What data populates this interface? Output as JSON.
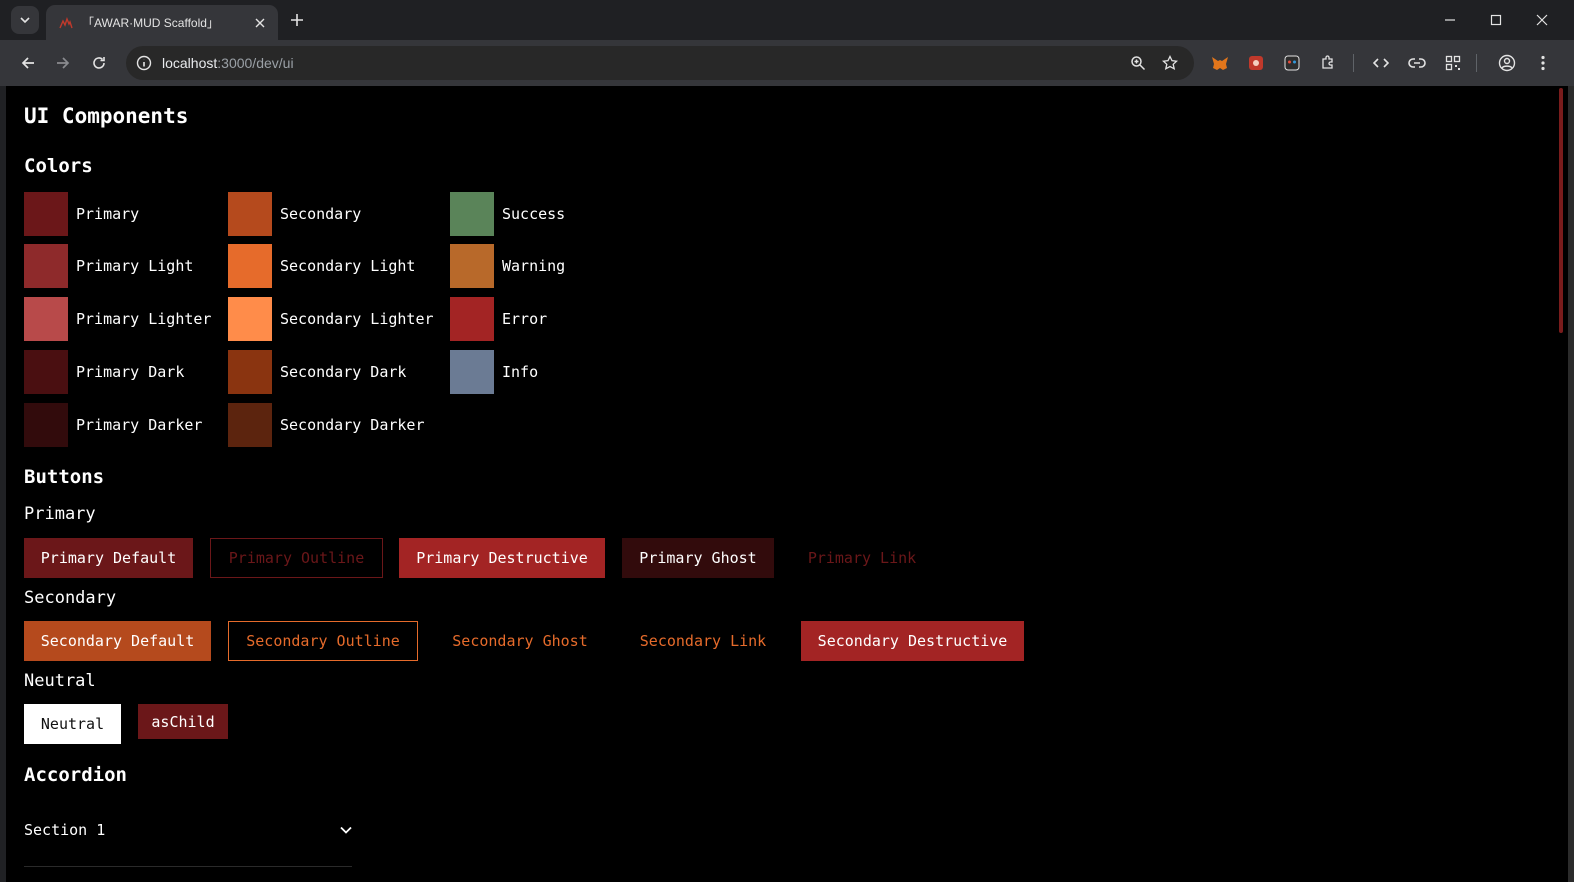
{
  "browser": {
    "tab_title": "「AWAR·MUD Scaffold」",
    "url_host": "localhost",
    "url_path": ":3000/dev/ui"
  },
  "page": {
    "title": "UI Components",
    "colors_heading": "Colors",
    "swatches": {
      "primary": [
        {
          "label": "Primary",
          "color": "#6b1719"
        },
        {
          "label": "Primary Light",
          "color": "#8e2a2b"
        },
        {
          "label": "Primary Lighter",
          "color": "#b84a4a"
        },
        {
          "label": "Primary Dark",
          "color": "#4a0f11"
        },
        {
          "label": "Primary Darker",
          "color": "#320b0c"
        }
      ],
      "secondary": [
        {
          "label": "Secondary",
          "color": "#b54a1d"
        },
        {
          "label": "Secondary Light",
          "color": "#e66b2b"
        },
        {
          "label": "Secondary Lighter",
          "color": "#ff8c4a"
        },
        {
          "label": "Secondary Dark",
          "color": "#8a3410"
        },
        {
          "label": "Secondary Darker",
          "color": "#5c240e"
        }
      ],
      "status": [
        {
          "label": "Success",
          "color": "#5a8459"
        },
        {
          "label": "Warning",
          "color": "#b8692a"
        },
        {
          "label": "Error",
          "color": "#a32424"
        },
        {
          "label": "Info",
          "color": "#6b7b94"
        }
      ]
    },
    "buttons_heading": "Buttons",
    "primary_heading": "Primary",
    "primary_buttons": {
      "default": "Primary Default",
      "outline": "Primary Outline",
      "destructive": "Primary Destructive",
      "ghost": "Primary Ghost",
      "link": "Primary Link"
    },
    "secondary_heading": "Secondary",
    "secondary_buttons": {
      "default": "Secondary Default",
      "outline": "Secondary Outline",
      "ghost": "Secondary Ghost",
      "link": "Secondary Link",
      "destructive": "Secondary Destructive"
    },
    "neutral_heading": "Neutral",
    "neutral_buttons": {
      "neutral": "Neutral",
      "as_child": "asChild"
    },
    "accordion_heading": "Accordion",
    "accordion_items": [
      "Section 1"
    ]
  }
}
